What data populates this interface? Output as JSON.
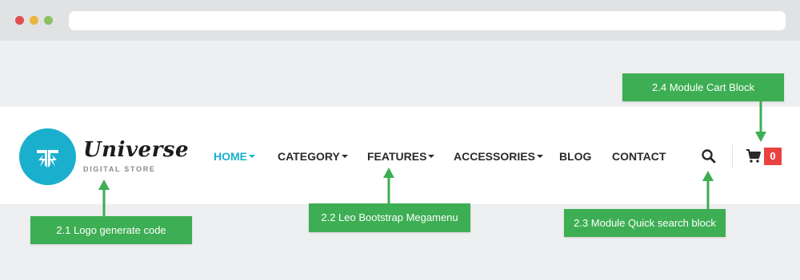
{
  "browser": {
    "window_controls": [
      "close",
      "minimize",
      "maximize"
    ]
  },
  "header": {
    "logo": {
      "name": "Universe",
      "tagline": "DIGITAL STORE",
      "brand_color": "#1ab0cd"
    },
    "nav": {
      "items": [
        {
          "label": "HOME",
          "active": true,
          "has_dropdown": true
        },
        {
          "label": "CATEGORY",
          "active": false,
          "has_dropdown": true
        },
        {
          "label": "FEATURES",
          "active": false,
          "has_dropdown": true
        },
        {
          "label": "ACCESSORIES",
          "active": false,
          "has_dropdown": true
        },
        {
          "label": "BLOG",
          "active": false,
          "has_dropdown": false
        },
        {
          "label": "CONTACT",
          "active": false,
          "has_dropdown": false
        }
      ],
      "active_color": "#1ab0cd"
    },
    "search": {
      "icon": "search-icon"
    },
    "cart": {
      "icon": "cart-icon",
      "count": "0",
      "badge_color": "#e84243"
    }
  },
  "callouts": {
    "logo": "2.1 Logo generate code",
    "megamenu": "2.2 Leo Bootstrap Megamenu",
    "quick_search": "2.3 Module Quick search block",
    "cart_block": "2.4 Module Cart Block",
    "color": "#3dae53"
  }
}
